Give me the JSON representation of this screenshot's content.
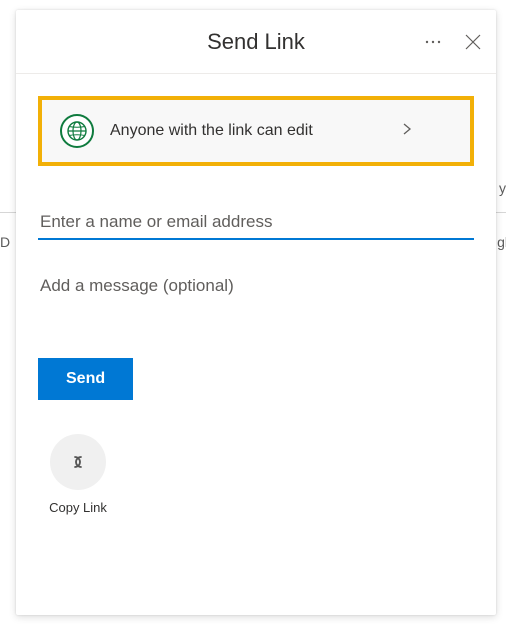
{
  "header": {
    "title": "Send Link"
  },
  "permission": {
    "label": "Anyone with the link can edit"
  },
  "recipients": {
    "placeholder": "Enter a name or email address",
    "value": ""
  },
  "message": {
    "placeholder": "Add a message (optional)",
    "value": ""
  },
  "actions": {
    "send_label": "Send",
    "copy_link_label": "Copy Link"
  },
  "icons": {
    "more": "more-icon",
    "close": "close-icon",
    "globe": "globe-icon",
    "chevron_right": "chevron-right-icon",
    "link": "link-icon"
  },
  "colors": {
    "primary": "#0078d4",
    "highlight_border": "#f2b007",
    "globe_green": "#0f7b3e"
  }
}
